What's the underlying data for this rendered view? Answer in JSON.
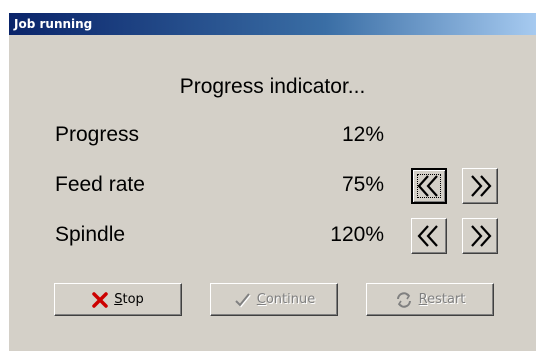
{
  "window": {
    "title": "Job running"
  },
  "heading": "Progress indicator...",
  "rows": [
    {
      "label": "Progress",
      "value": "12%"
    },
    {
      "label": "Feed rate",
      "value": "75%"
    },
    {
      "label": "Spindle",
      "value": "120%"
    }
  ],
  "buttons": {
    "stop": {
      "mnemonic": "S",
      "rest": "top",
      "icon": "x-icon",
      "color": "#cc0000"
    },
    "continue": {
      "mnemonic": "C",
      "rest": "ontinue",
      "icon": "checkmark-icon",
      "disabled": true
    },
    "restart": {
      "mnemonic": "R",
      "rest": "estart",
      "icon": "refresh-icon",
      "disabled": true
    }
  },
  "step_buttons": {
    "decrease_icon": "double-chevron-left-icon",
    "increase_icon": "double-chevron-right-icon"
  }
}
